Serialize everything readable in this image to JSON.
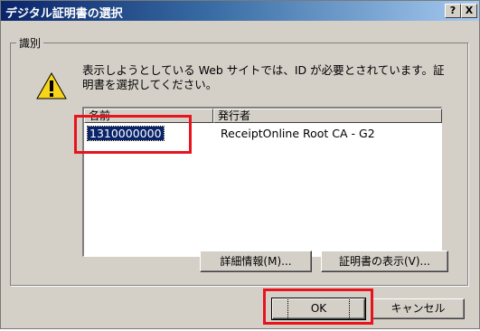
{
  "window": {
    "title": "デジタル証明書の選択",
    "help_label": "?",
    "close_label": "X"
  },
  "group": {
    "label": "識別",
    "message": "表示しようとしている Web サイトでは、ID が必要とされています。証明書を選択してください。",
    "icon": "warning-icon"
  },
  "list": {
    "columns": [
      "名前",
      "発行者"
    ],
    "rows": [
      {
        "name": "1310000000",
        "issuer": "ReceiptOnline Root CA - G2",
        "selected": true
      }
    ]
  },
  "buttons": {
    "details": "詳細情報(M)...",
    "view_cert": "証明書の表示(V)...",
    "ok": "OK",
    "cancel": "キャンセル"
  },
  "colors": {
    "highlight": "#e8141d",
    "titlebar": "#0a246a",
    "selection": "#0a246a"
  }
}
